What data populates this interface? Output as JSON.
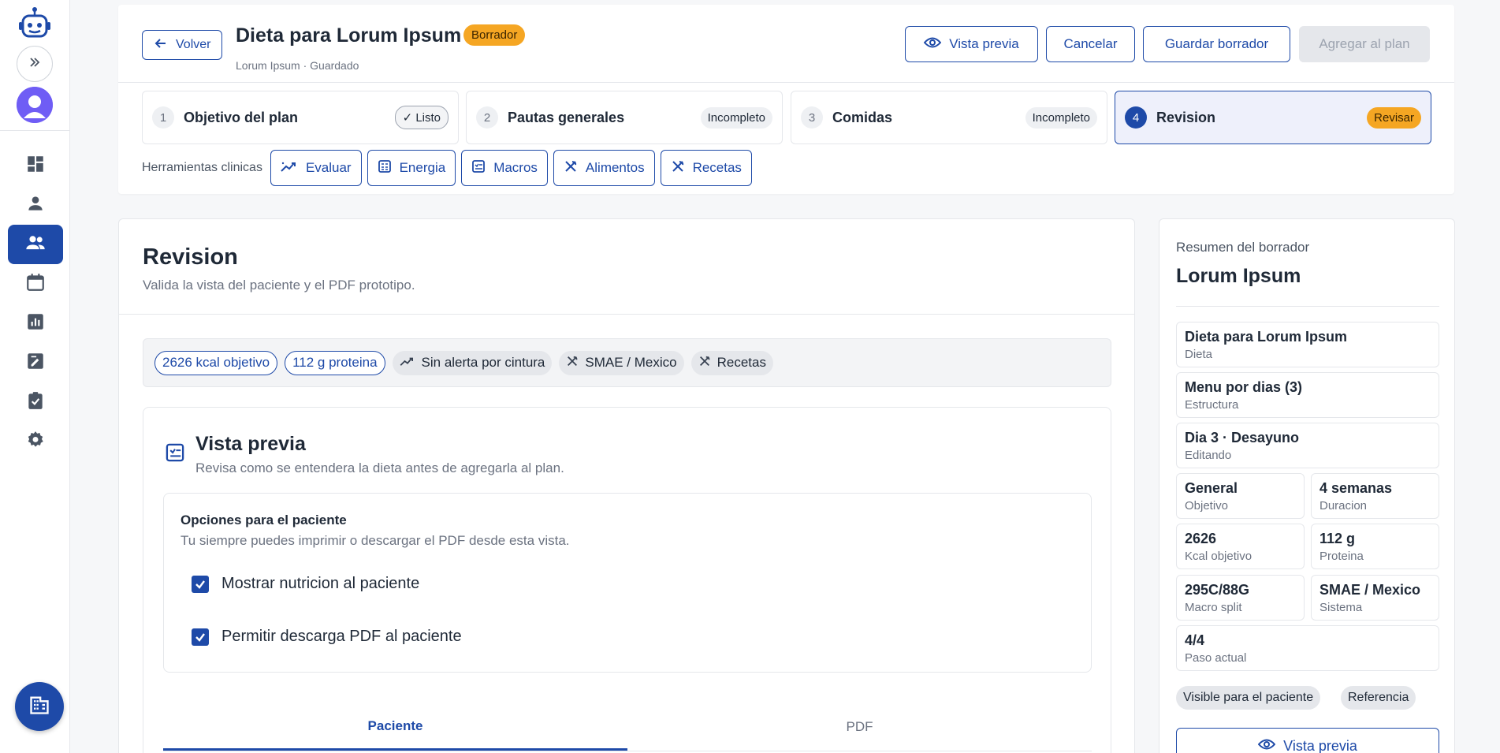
{
  "sidebar": {
    "icons": [
      "robot-logo-icon",
      "chevrons-right-icon",
      "avatar",
      "dashboard-icon",
      "person-icon",
      "people-icon",
      "calendar-icon",
      "chart-icon",
      "note-edit-icon",
      "clipboard-check-icon",
      "gear-icon",
      "building-icon"
    ],
    "active_item": "people"
  },
  "header": {
    "back_label": "Volver",
    "title": "Dieta para Lorum Ipsum",
    "status_badge": "Borrador",
    "subtitle": "Lorum Ipsum · Guardado",
    "preview_label": "Vista previa",
    "cancel_label": "Cancelar",
    "save_draft_label": "Guardar borrador",
    "add_plan_label": "Agregar al plan"
  },
  "steps": [
    {
      "number": "1",
      "label": "Objetivo del plan",
      "status": "✓ Listo"
    },
    {
      "number": "2",
      "label": "Pautas generales",
      "status": "Incompleto"
    },
    {
      "number": "3",
      "label": "Comidas",
      "status": "Incompleto"
    },
    {
      "number": "4",
      "label": "Revision",
      "status": "Revisar"
    }
  ],
  "tools": {
    "label": "Herramientas clinicas",
    "items": [
      "Evaluar",
      "Energia",
      "Macros",
      "Alimentos",
      "Recetas"
    ]
  },
  "main": {
    "title": "Revision",
    "description": "Valida la vista del paciente y el PDF prototipo.",
    "chips": [
      "2626 kcal objetivo",
      "112 g proteina",
      "Sin alerta por cintura",
      "SMAE / Mexico",
      "Recetas"
    ],
    "preview": {
      "title": "Vista previa",
      "description": "Revisa como se entendera la dieta antes de agregarla al plan.",
      "options_title": "Opciones para el paciente",
      "options_description": "Tu siempre puedes imprimir o descargar el PDF desde esta vista.",
      "options": [
        {
          "label": "Mostrar nutricion al paciente",
          "checked": true
        },
        {
          "label": "Permitir descarga PDF al paciente",
          "checked": true
        }
      ],
      "tabs": [
        "Paciente",
        "PDF"
      ],
      "active_tab": "Paciente"
    }
  },
  "summary": {
    "label": "Resumen del borrador",
    "name": "Lorum Ipsum",
    "cards": [
      {
        "value": "Dieta para Lorum Ipsum",
        "caption": "Dieta"
      },
      {
        "value": "Menu por dias (3)",
        "caption": "Estructura"
      },
      {
        "value": "Dia 3 · Desayuno",
        "caption": "Editando"
      },
      {
        "value": "General",
        "caption": "Objetivo"
      },
      {
        "value": "4 semanas",
        "caption": "Duracion"
      },
      {
        "value": "2626",
        "caption": "Kcal objetivo"
      },
      {
        "value": "112 g",
        "caption": "Proteina"
      },
      {
        "value": "295C/88G",
        "caption": "Macro split"
      },
      {
        "value": "SMAE / Mexico",
        "caption": "Sistema"
      },
      {
        "value": "4/4",
        "caption": "Paso actual"
      }
    ],
    "tags": [
      "Visible para el paciente",
      "Referencia"
    ],
    "preview_label": "Vista previa"
  },
  "colors": {
    "primary": "#1e4aa8",
    "warning": "#f5a623",
    "background": "#f6f7f9"
  }
}
